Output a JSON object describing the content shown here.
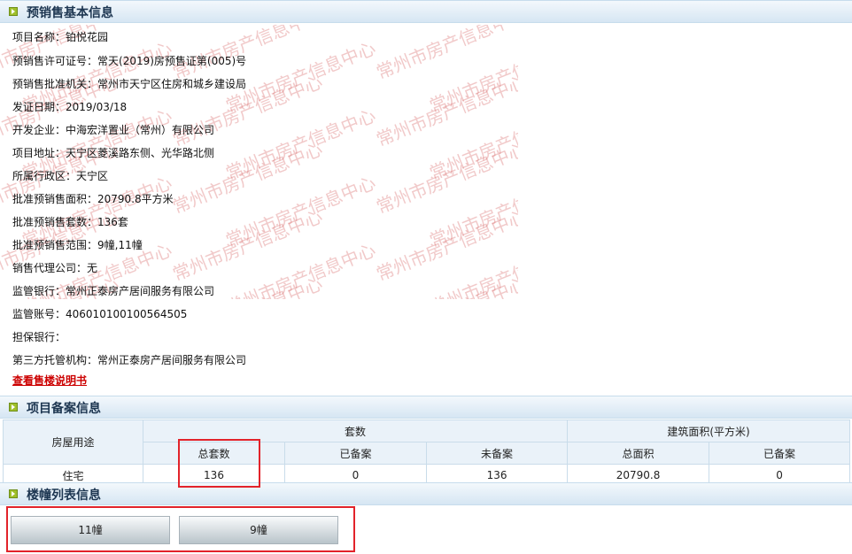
{
  "sections": {
    "basic_info_title": "预销售基本信息",
    "record_info_title": "项目备案信息",
    "building_list_title": "楼幢列表信息"
  },
  "basic_info": [
    {
      "label": "项目名称：",
      "value": "铂悦花园"
    },
    {
      "label": "预销售许可证号：",
      "value": "常天(2019)房预售证第(005)号"
    },
    {
      "label": "预销售批准机关：",
      "value": "常州市天宁区住房和城乡建设局"
    },
    {
      "label": "发证日期：",
      "value": "2019/03/18"
    },
    {
      "label": "开发企业：",
      "value": "中海宏洋置业（常州）有限公司"
    },
    {
      "label": "项目地址：",
      "value": "天宁区菱溪路东侧、光华路北侧"
    },
    {
      "label": "所属行政区：",
      "value": "天宁区"
    },
    {
      "label": "批准预销售面积：",
      "value": "20790.8平方米"
    },
    {
      "label": "批准预销售套数：",
      "value": "136套"
    },
    {
      "label": "批准预销售范围：",
      "value": "9幢,11幢"
    },
    {
      "label": "销售代理公司：",
      "value": "无"
    },
    {
      "label": "监管银行：",
      "value": "常州正泰房产居间服务有限公司"
    },
    {
      "label": "监管账号：",
      "value": "406010100100564505"
    },
    {
      "label": "担保银行：",
      "value": ""
    },
    {
      "label": "第三方托管机构：",
      "value": "常州正泰房产居间服务有限公司"
    }
  ],
  "doc_link": "查看售楼说明书",
  "watermark_text": "常州市房产信息中心",
  "record_table": {
    "col_usage": "房屋用途",
    "group_units": "套数",
    "group_area": "建筑面积(平方米)",
    "sub_headers": [
      "总套数",
      "已备案",
      "未备案",
      "总面积",
      "已备案"
    ],
    "rows": [
      {
        "usage": "住宅",
        "total_units": "136",
        "recorded_units": "0",
        "unrecorded_units": "136",
        "total_area": "20790.8",
        "recorded_area": "0"
      }
    ]
  },
  "buildings": [
    "11幢",
    "9幢"
  ],
  "colors": {
    "highlight": "#e2232a",
    "link": "#cc0000",
    "header_text": "#1c3550"
  }
}
